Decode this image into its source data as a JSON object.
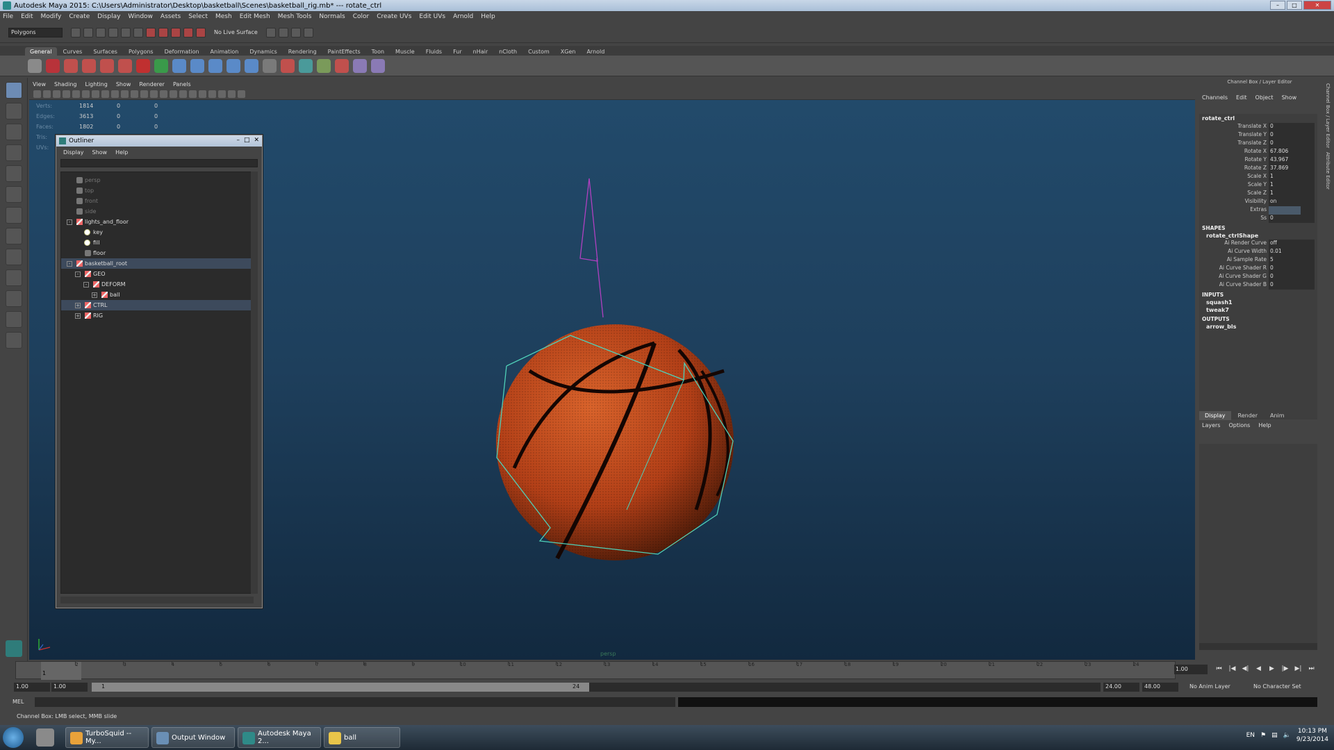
{
  "window": {
    "title": "Autodesk Maya 2015: C:\\Users\\Administrator\\Desktop\\basketball\\Scenes\\basketball_rig.mb*   ---   rotate_ctrl"
  },
  "menubar": [
    "File",
    "Edit",
    "Modify",
    "Create",
    "Display",
    "Window",
    "Assets",
    "Select",
    "Mesh",
    "Edit Mesh",
    "Mesh Tools",
    "Normals",
    "Color",
    "Create UVs",
    "Edit UVs",
    "Arnold",
    "Help"
  ],
  "statusline": {
    "mode": "Polygons",
    "live_surface": "No Live Surface"
  },
  "shelf": {
    "tabs": [
      "General",
      "Curves",
      "Surfaces",
      "Polygons",
      "Deformation",
      "Animation",
      "Dynamics",
      "Rendering",
      "PaintEffects",
      "Toon",
      "Muscle",
      "Fluids",
      "Fur",
      "nHair",
      "nCloth",
      "Custom",
      "XGen",
      "Arnold"
    ],
    "active_tab": "General"
  },
  "viewport": {
    "menu": [
      "View",
      "Shading",
      "Lighting",
      "Show",
      "Renderer",
      "Panels"
    ],
    "hud": [
      {
        "label": "Verts:",
        "a": "1814",
        "b": "0",
        "c": "0"
      },
      {
        "label": "Edges:",
        "a": "3613",
        "b": "0",
        "c": "0"
      },
      {
        "label": "Faces:",
        "a": "1802",
        "b": "0",
        "c": "0"
      },
      {
        "label": "Tris:",
        "a": "",
        "b": "",
        "c": ""
      },
      {
        "label": "UVs:",
        "a": "",
        "b": "",
        "c": ""
      }
    ],
    "camera_label": "persp"
  },
  "outliner": {
    "title": "Outliner",
    "menu": [
      "Display",
      "Show",
      "Help"
    ],
    "rows": [
      {
        "label": "persp",
        "depth": 0,
        "icon": "cam",
        "dim": true,
        "expand": ""
      },
      {
        "label": "top",
        "depth": 0,
        "icon": "cam",
        "dim": true,
        "expand": ""
      },
      {
        "label": "front",
        "depth": 0,
        "icon": "cam",
        "dim": true,
        "expand": ""
      },
      {
        "label": "side",
        "depth": 0,
        "icon": "cam",
        "dim": true,
        "expand": ""
      },
      {
        "label": "lights_and_floor",
        "depth": 0,
        "icon": "xf",
        "dim": false,
        "expand": "-"
      },
      {
        "label": "key",
        "depth": 1,
        "icon": "lt",
        "dim": false,
        "expand": ""
      },
      {
        "label": "fill",
        "depth": 1,
        "icon": "lt",
        "dim": false,
        "expand": ""
      },
      {
        "label": "floor",
        "depth": 1,
        "icon": "cam",
        "dim": false,
        "expand": ""
      },
      {
        "label": "basketball_root",
        "depth": 0,
        "icon": "xf",
        "dim": false,
        "expand": "-",
        "selected": true
      },
      {
        "label": "GEO",
        "depth": 1,
        "icon": "xf",
        "dim": false,
        "expand": "-"
      },
      {
        "label": "DEFORM",
        "depth": 2,
        "icon": "xf",
        "dim": false,
        "expand": "-"
      },
      {
        "label": "ball",
        "depth": 3,
        "icon": "xf",
        "dim": false,
        "expand": "+"
      },
      {
        "label": "CTRL",
        "depth": 1,
        "icon": "xf",
        "dim": false,
        "expand": "+",
        "selected": true
      },
      {
        "label": "RIG",
        "depth": 1,
        "icon": "xf",
        "dim": false,
        "expand": "+"
      }
    ]
  },
  "channelbox": {
    "title": "Channel Box / Layer Editor",
    "menu": [
      "Channels",
      "Edit",
      "Object",
      "Show"
    ],
    "node": "rotate_ctrl",
    "attributes": [
      {
        "name": "Translate X",
        "value": "0"
      },
      {
        "name": "Translate Y",
        "value": "0"
      },
      {
        "name": "Translate Z",
        "value": "0"
      },
      {
        "name": "Rotate X",
        "value": "67.806"
      },
      {
        "name": "Rotate Y",
        "value": "43.967"
      },
      {
        "name": "Rotate Z",
        "value": "37.869"
      },
      {
        "name": "Scale X",
        "value": "1"
      },
      {
        "name": "Scale Y",
        "value": "1"
      },
      {
        "name": "Scale Z",
        "value": "1"
      },
      {
        "name": "Visibility",
        "value": "on"
      },
      {
        "name": "Extras",
        "value": "",
        "bar": true
      },
      {
        "name": "Ss",
        "value": "0"
      }
    ],
    "shapes_header": "SHAPES",
    "shape_node": "rotate_ctrlShape",
    "shape_attributes": [
      {
        "name": "Ai Render Curve",
        "value": "off"
      },
      {
        "name": "Ai Curve Width",
        "value": "0.01"
      },
      {
        "name": "Ai Sample Rate",
        "value": "5"
      },
      {
        "name": "Ai Curve Shader R",
        "value": "0"
      },
      {
        "name": "Ai Curve Shader G",
        "value": "0"
      },
      {
        "name": "Ai Curve Shader B",
        "value": "0"
      }
    ],
    "inputs_header": "INPUTS",
    "inputs": [
      "squash1",
      "tweak7"
    ],
    "outputs_header": "OUTPUTS",
    "outputs": [
      "arrow_bls"
    ]
  },
  "side_tabs": [
    "Channel Box / Layer Editor",
    "Attribute Editor"
  ],
  "layers": {
    "tabs": [
      "Display",
      "Render",
      "Anim"
    ],
    "active_tab": "Display",
    "menu": [
      "Layers",
      "Options",
      "Help"
    ]
  },
  "timeline": {
    "ticks": [
      "1",
      "2",
      "3",
      "4",
      "5",
      "6",
      "7",
      "8",
      "9",
      "10",
      "11",
      "12",
      "13",
      "14",
      "15",
      "16",
      "17",
      "18",
      "19",
      "20",
      "21",
      "22",
      "23",
      "24"
    ],
    "current_frame": "1",
    "current_time_field": "1.00"
  },
  "range": {
    "start_field": "1.00",
    "inner_start": "1.00",
    "slider_start": "1",
    "slider_end": "24",
    "end_field": "24.00",
    "anim_end": "48.00",
    "anim_layer": "No Anim Layer",
    "char_set": "No Character Set"
  },
  "cmdline": {
    "label": "MEL"
  },
  "helpline": {
    "text": "Channel Box: LMB select, MMB slide"
  },
  "taskbar": {
    "tasks": [
      {
        "label": "TurboSquid -- My...",
        "color": "#e8a23a"
      },
      {
        "label": "Output Window",
        "color": "#6a8fb5"
      },
      {
        "label": "Autodesk Maya 2...",
        "color": "#2f8a88"
      },
      {
        "label": "ball",
        "color": "#e8c54a"
      }
    ],
    "lang": "EN",
    "time": "10:13 PM",
    "date": "9/23/2014"
  }
}
